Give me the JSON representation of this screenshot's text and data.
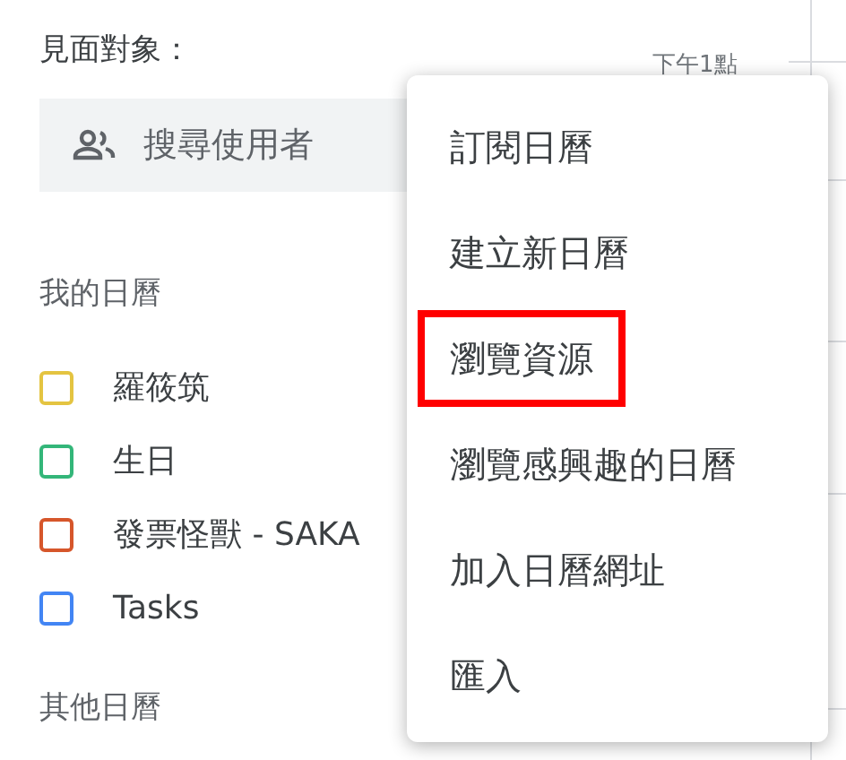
{
  "guests": {
    "label": "見面對象：",
    "search": {
      "placeholder": "搜尋使用者"
    }
  },
  "time_label": "下午1點",
  "my_calendars": {
    "title": "我的日曆",
    "items": [
      {
        "name": "羅筱筑",
        "color": "#e4c441",
        "checked": false
      },
      {
        "name": "生日",
        "color": "#33b679",
        "checked": false
      },
      {
        "name": "發票怪獸 - SAKA",
        "color": "#d6562b",
        "checked": false
      },
      {
        "name": "Tasks",
        "color": "#4285f4",
        "checked": false
      }
    ]
  },
  "other_calendars": {
    "title": "其他日曆"
  },
  "menu": {
    "items": [
      {
        "label": "訂閱日曆",
        "highlighted": false
      },
      {
        "label": "建立新日曆",
        "highlighted": false
      },
      {
        "label": "瀏覽資源",
        "highlighted": true
      },
      {
        "label": "瀏覽感興趣的日曆",
        "highlighted": false
      },
      {
        "label": "加入日曆網址",
        "highlighted": false
      },
      {
        "label": "匯入",
        "highlighted": false
      }
    ]
  }
}
